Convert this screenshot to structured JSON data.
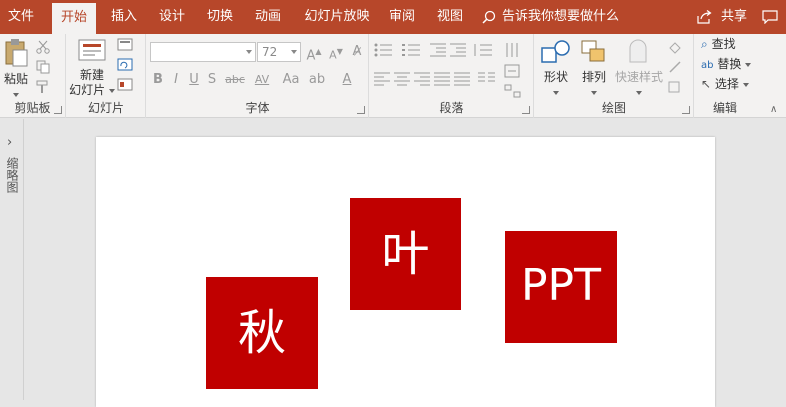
{
  "tabs": [
    {
      "label": "文件"
    },
    {
      "label": "开始"
    },
    {
      "label": "插入"
    },
    {
      "label": "设计"
    },
    {
      "label": "切换"
    },
    {
      "label": "动画"
    },
    {
      "label": "幻灯片放映"
    },
    {
      "label": "审阅"
    },
    {
      "label": "视图"
    }
  ],
  "active_tab": "开始",
  "tell_me": "告诉我你想要做什么",
  "share_label": "共享",
  "ribbon": {
    "clipboard": {
      "paste": "粘贴",
      "label": "剪贴板"
    },
    "slides": {
      "new_slide_line1": "新建",
      "new_slide_line2": "幻灯片",
      "label": "幻灯片"
    },
    "font": {
      "font_name": "",
      "font_size": "72",
      "bold": "B",
      "italic": "I",
      "underline": "U",
      "shadow": "S",
      "strike": "abc",
      "spacing": "AV",
      "case": "Aa",
      "label": "字体"
    },
    "paragraph": {
      "label": "段落"
    },
    "drawing": {
      "shapes": "形状",
      "arrange": "排列",
      "quick_styles": "快速样式",
      "label": "绘图"
    },
    "editing": {
      "find": "查找",
      "replace": "替换",
      "select": "选择",
      "label": "编辑"
    }
  },
  "thumbnail_pane_label": "缩略图",
  "slide": {
    "boxes": [
      {
        "text": "秋"
      },
      {
        "text": "叶"
      },
      {
        "text": "PPT"
      }
    ]
  },
  "colors": {
    "accent": "#b7472a",
    "box_fill": "#c00000"
  }
}
